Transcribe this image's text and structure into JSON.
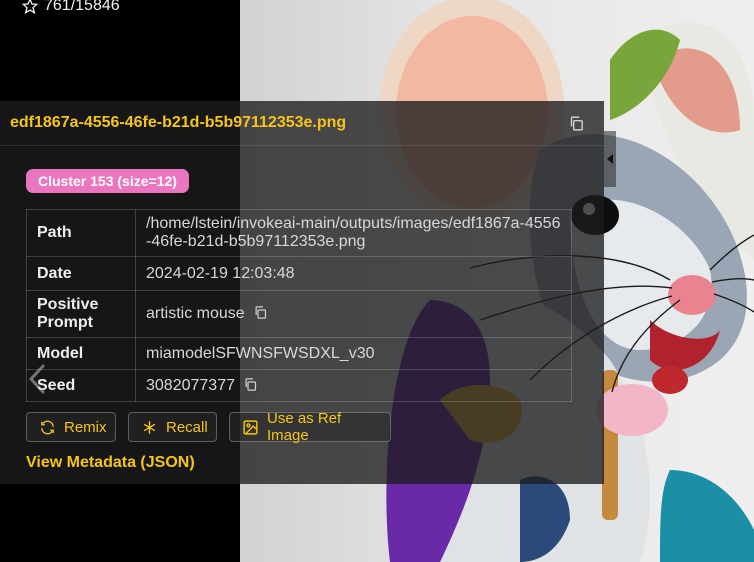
{
  "gallery": {
    "counter": "761/15846"
  },
  "panel": {
    "filename": "edf1867a-4556-46fe-b21d-b5b97112353e.png",
    "cluster_badge": "Cluster 153 (size=12)",
    "rows": [
      {
        "key": "Path",
        "value": "/home/lstein/invokeai-main/outputs/images/edf1867a-4556-46fe-b21d-b5b97112353e.png"
      },
      {
        "key": "Date",
        "value": "2024-02-19 12:03:48"
      },
      {
        "key": "Positive Prompt",
        "value": "artistic mouse"
      },
      {
        "key": "Model",
        "value": "miamodelSFWNSFWSDXL_v30"
      },
      {
        "key": "Seed",
        "value": "3082077377"
      }
    ],
    "buttons": {
      "remix": "Remix",
      "recall": "Recall",
      "use_as_ref": "Use as Ref Image"
    },
    "view_metadata": "View Metadata (JSON)"
  },
  "colors": {
    "accent": "#f5c518",
    "badge": "#ea76c0"
  },
  "icons": [
    "star-icon",
    "copy-icon",
    "refresh-icon",
    "asterisk-icon",
    "image-icon",
    "chevron-left-icon",
    "collapse-arrow-icon"
  ]
}
